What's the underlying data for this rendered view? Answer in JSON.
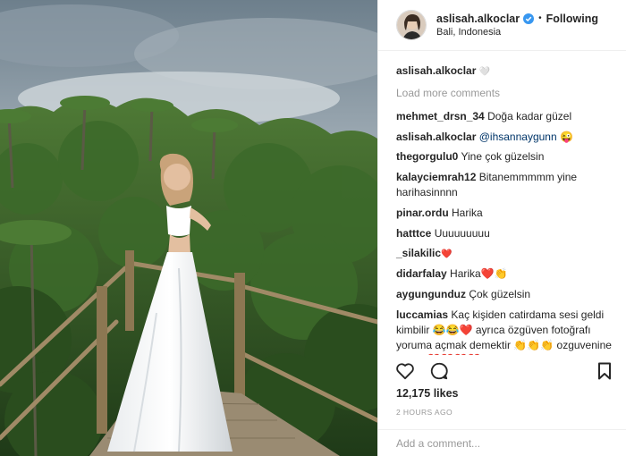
{
  "post": {
    "author": "aslisah.alkoclar",
    "location": "Bali, Indonesia",
    "following_label": "Following",
    "separator": "•",
    "caption_emoji": "🤍"
  },
  "comments": {
    "load_more": "Load more comments",
    "items": [
      {
        "user": "mehmet_drsn_34",
        "text": "Doğa kadar güzel"
      },
      {
        "user": "aslisah.alkoclar",
        "text": "@ihsannaygunn 😜"
      },
      {
        "user": "thegorgulu0",
        "text": "Yine çok güzelsin"
      },
      {
        "user": "kalayciemrah12",
        "text": "Bitanemmmmm yine harihasinnnn"
      },
      {
        "user": "pinar.ordu",
        "text": "Harika"
      },
      {
        "user": "hatttce",
        "text": "Uuuuuuuuu"
      },
      {
        "user": "_silakilic",
        "text": "❤️"
      },
      {
        "user": "didarfalay",
        "text": "Harika❤️👏"
      },
      {
        "user": "aygungunduz",
        "text": "Çok güzelsin"
      },
      {
        "user": "luccamias",
        "text": "Kaç kişiden catirdama sesi geldi kimbilir 😂😂❤️ ayrıca özgüven fotoğrafı yoruma açmak demektir 👏👏👏 ozguvenine sağlık ❤️❤️❤️❤️"
      }
    ]
  },
  "footer": {
    "likes": "12,175 likes",
    "time": "2 HOURS AGO",
    "add_comment_placeholder": "Add a comment..."
  },
  "icons": {
    "like": "heart-icon",
    "comment": "comment-bubble-icon",
    "save": "bookmark-icon",
    "verified": "verified-badge-icon"
  },
  "colors": {
    "verified": "#3897f0",
    "muted": "#999999",
    "border": "#efefef"
  }
}
